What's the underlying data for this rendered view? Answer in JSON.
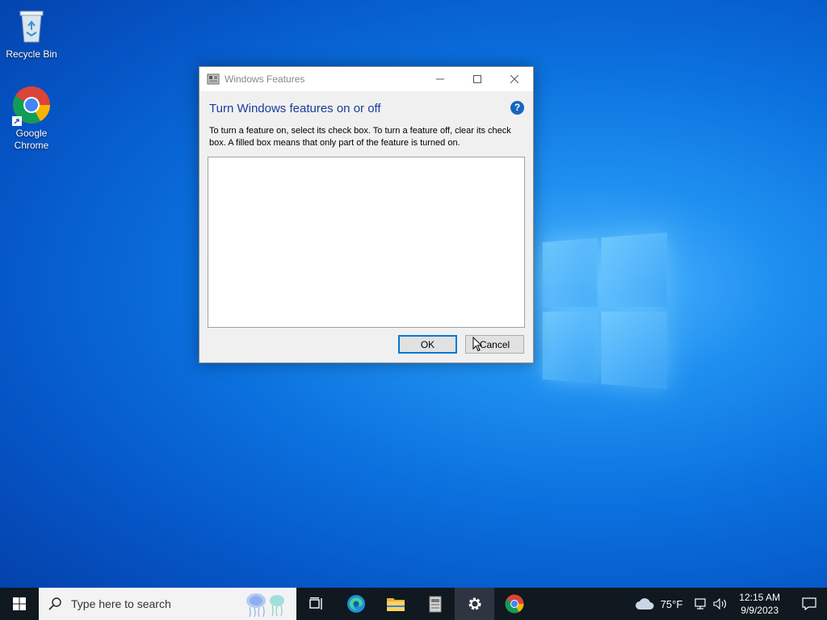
{
  "desktop": {
    "icons": [
      {
        "label": "Recycle Bin",
        "icon": "recycle-bin-icon"
      },
      {
        "label": "Google Chrome",
        "icon": "chrome-icon"
      }
    ]
  },
  "dialog": {
    "title": "Windows Features",
    "heading": "Turn Windows features on or off",
    "description": "To turn a feature on, select its check box. To turn a feature off, clear its check box. A filled box means that only part of the feature is turned on.",
    "help_glyph": "?",
    "ok_label": "OK",
    "cancel_label": "Cancel",
    "feature_items": []
  },
  "taskbar": {
    "search_placeholder": "Type here to search",
    "apps": [
      "task-view",
      "edge",
      "file-explorer",
      "windows-features",
      "settings",
      "chrome"
    ],
    "weather": "75°F",
    "time": "12:15 AM",
    "date": "9/9/2023"
  },
  "colors": {
    "accent": "#0078d7",
    "heading": "#1a3c9a",
    "taskbar": "#101820"
  }
}
